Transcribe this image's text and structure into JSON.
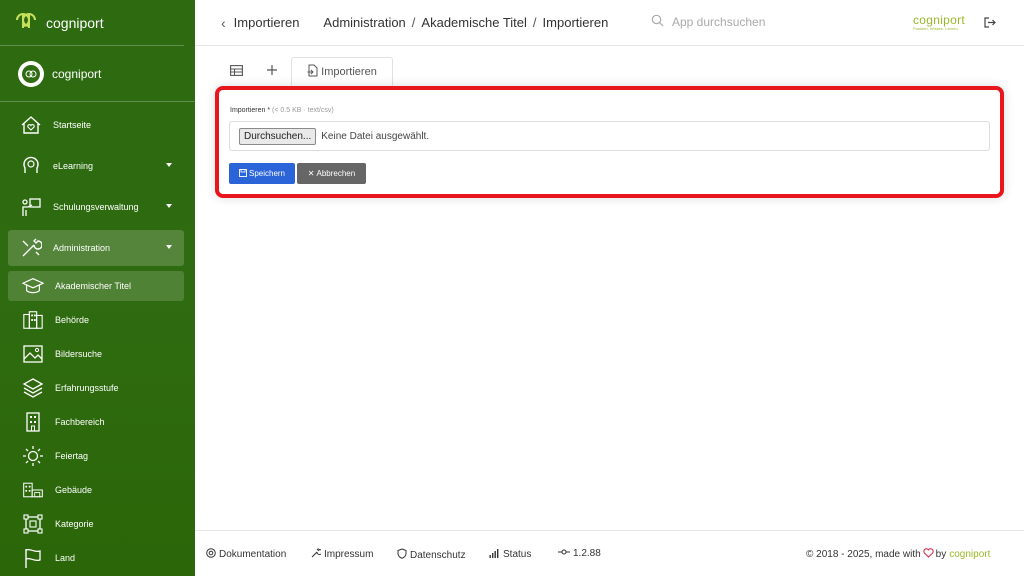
{
  "brand": {
    "name": "cogniport"
  },
  "user": {
    "name": "cogniport"
  },
  "sidebar": {
    "items": [
      {
        "label": "Startseite",
        "icon": "home-heart-icon"
      },
      {
        "label": "eLearning",
        "icon": "gear-head-icon",
        "has_caret": true
      },
      {
        "label": "Schulungsverwaltung",
        "icon": "presenter-icon",
        "has_caret": true
      },
      {
        "label": "Administration",
        "icon": "tools-icon",
        "has_caret": true,
        "active": true
      }
    ],
    "subitems": [
      {
        "label": "Akademischer Titel",
        "icon": "graduation-cap-icon",
        "active": true
      },
      {
        "label": "Behörde",
        "icon": "building-icon"
      },
      {
        "label": "Bildersuche",
        "icon": "image-icon"
      },
      {
        "label": "Erfahrungsstufe",
        "icon": "layers-icon"
      },
      {
        "label": "Fachbereich",
        "icon": "office-icon"
      },
      {
        "label": "Feiertag",
        "icon": "sun-icon"
      },
      {
        "label": "Gebäude",
        "icon": "buildings-icon"
      },
      {
        "label": "Kategorie",
        "icon": "category-icon"
      },
      {
        "label": "Land",
        "icon": "flag-icon"
      }
    ]
  },
  "header": {
    "back_label": "Importieren",
    "breadcrumb": [
      "Administration",
      "Akademische Titel",
      "Importieren"
    ],
    "breadcrumb_sep": "/",
    "search_placeholder": "App durchsuchen",
    "logo_text": "cogniport",
    "logo_tagline": "Punkten. Wissen. Lernen."
  },
  "tabs": {
    "import_label": "Importieren"
  },
  "form": {
    "label": "Importieren",
    "required_mark": "*",
    "hint": "(< 0.5 KB · text/csv)",
    "browse_label": "Durchsuchen...",
    "no_file_text": "Keine Datei ausgewählt.",
    "save_label": "Speichern",
    "cancel_label": "Abbrechen"
  },
  "footer": {
    "links": [
      {
        "label": "Dokumentation",
        "icon": "help-icon"
      },
      {
        "label": "Impressum",
        "icon": "wrench-icon"
      },
      {
        "label": "Datenschutz",
        "icon": "shield-icon"
      },
      {
        "label": "Status",
        "icon": "signal-icon"
      },
      {
        "label": "1.2.88",
        "icon": "commit-icon"
      }
    ],
    "copyright_prefix": "© 2018 - 2025, made with",
    "copyright_by": "by",
    "copyright_brand": "cogniport"
  },
  "colors": {
    "sidebar": "#2f6b10",
    "accent_logo": "#9ab82a",
    "highlight_border": "#e8151c",
    "save_button": "#2b63d9",
    "cancel_button": "#666666"
  }
}
